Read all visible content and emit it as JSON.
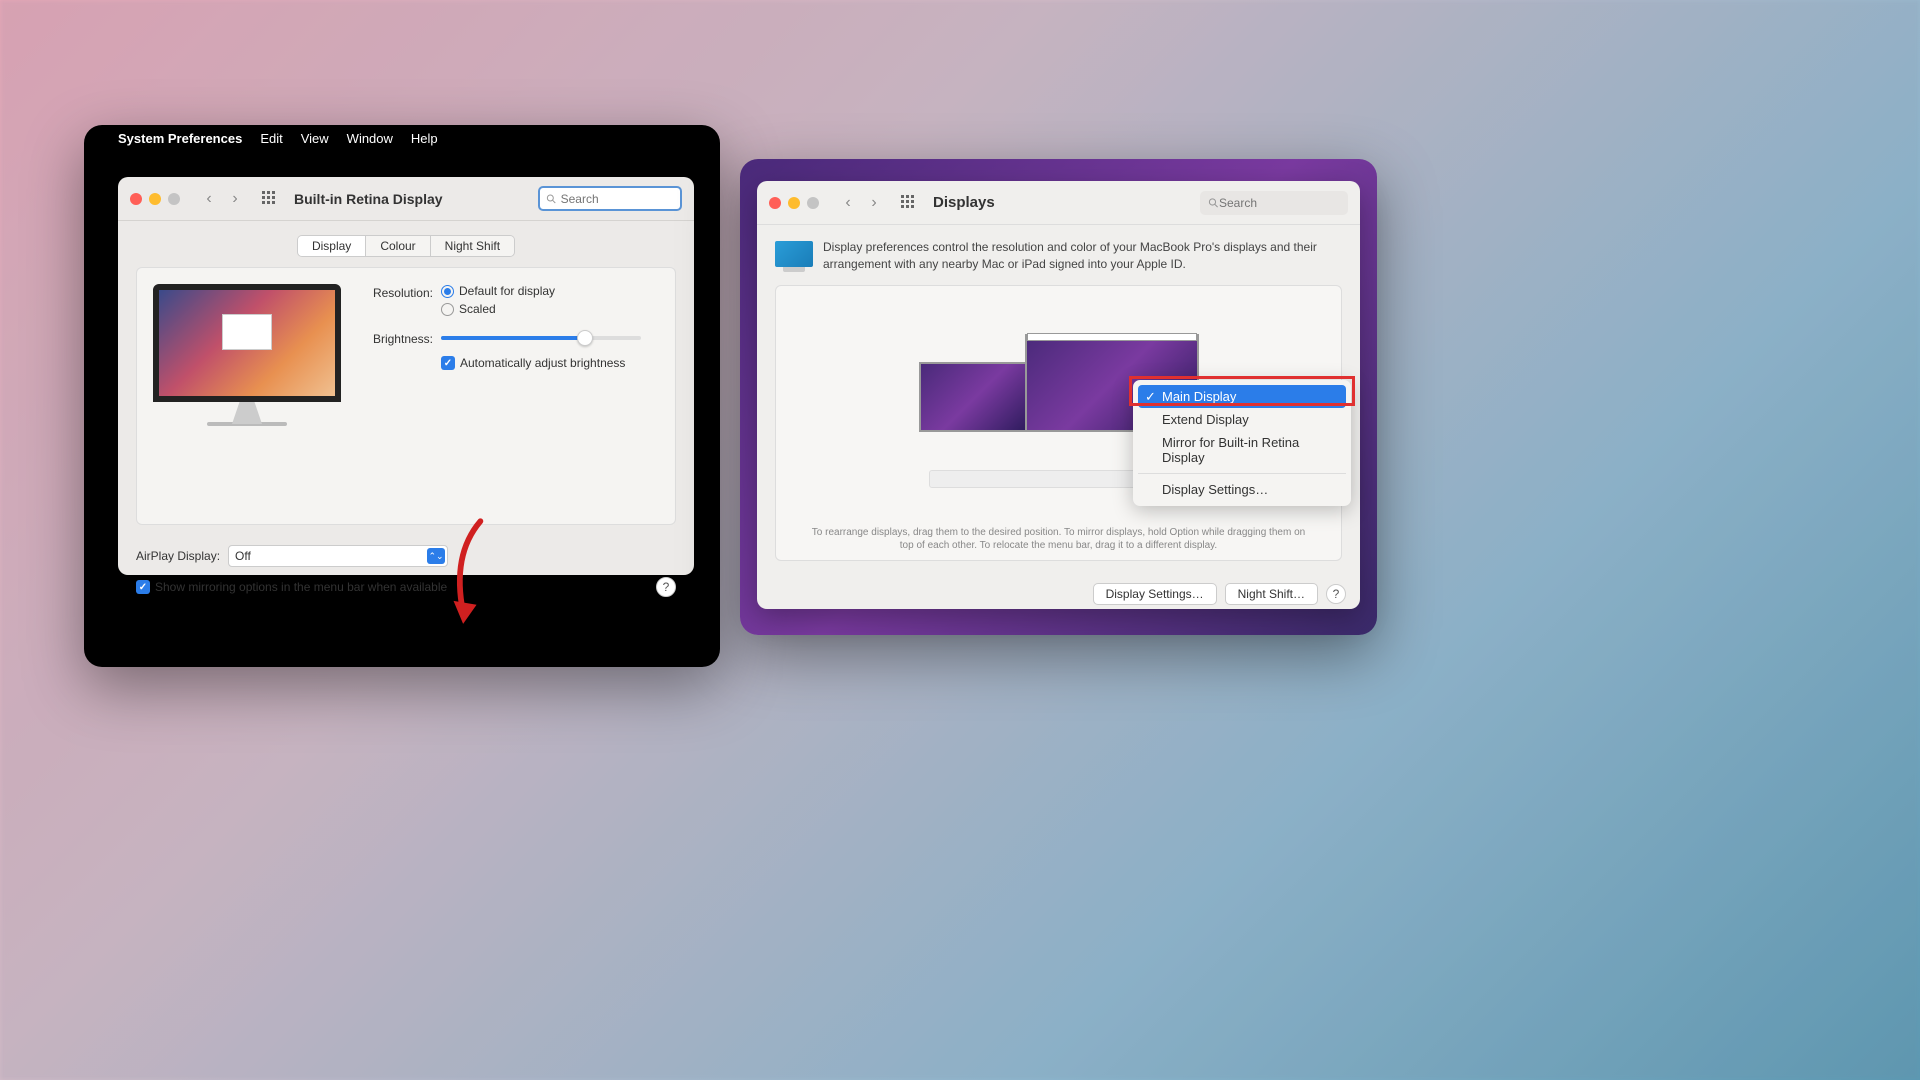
{
  "left": {
    "menubar": {
      "app": "System Preferences",
      "items": [
        "Edit",
        "View",
        "Window",
        "Help"
      ]
    },
    "window_title": "Built-in Retina Display",
    "search_placeholder": "Search",
    "tabs": {
      "display": "Display",
      "colour": "Colour",
      "night_shift": "Night Shift"
    },
    "resolution_label": "Resolution:",
    "resolution_default": "Default for display",
    "resolution_scaled": "Scaled",
    "brightness_label": "Brightness:",
    "brightness_value_pct": 72,
    "auto_brightness": "Automatically adjust brightness",
    "airplay_label": "AirPlay Display:",
    "airplay_value": "Off",
    "mirror_checkbox": "Show mirroring options in the menu bar when available"
  },
  "right": {
    "window_title": "Displays",
    "search_placeholder": "Search",
    "info_text": "Display preferences control the resolution and color of your MacBook Pro's displays and their arrangement with any nearby Mac or iPad signed into your Apple ID.",
    "rearrange_text": "To rearrange displays, drag them to the desired position. To mirror displays, hold Option while dragging them on top of each other. To relocate the menu bar, drag it to a different display.",
    "menu": {
      "main": "Main Display",
      "extend": "Extend Display",
      "mirror": "Mirror for Built-in Retina Display",
      "settings": "Display Settings…"
    },
    "buttons": {
      "display_settings": "Display Settings…",
      "night_shift": "Night Shift…"
    }
  }
}
